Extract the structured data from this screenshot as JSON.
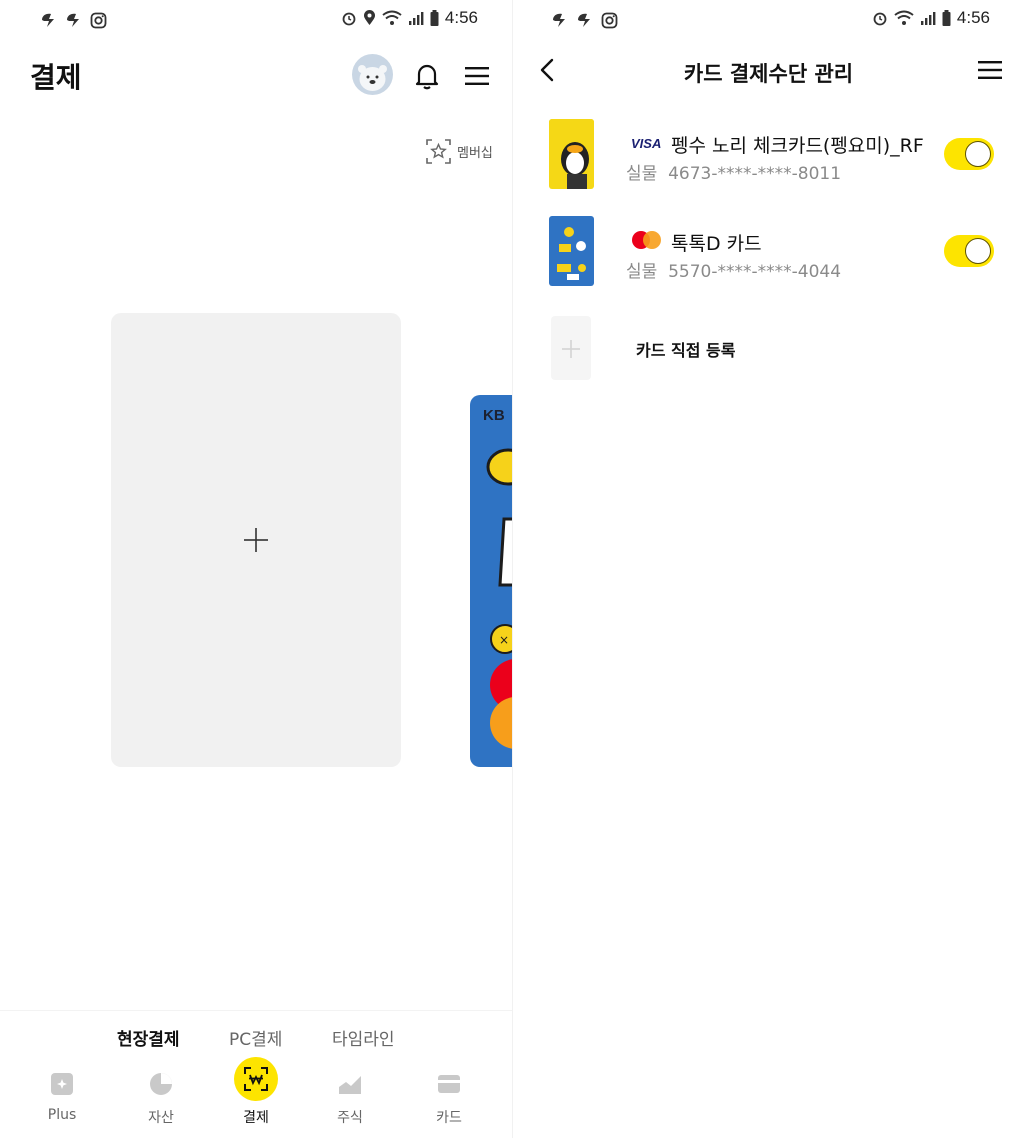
{
  "status_bar": {
    "time": "4:56"
  },
  "left": {
    "header": {
      "title": "결제"
    },
    "membership_label": "멤버십",
    "peek_card_text": "KB",
    "subtabs": [
      {
        "label": "현장결제",
        "active": true
      },
      {
        "label": "PC결제",
        "active": false
      },
      {
        "label": "타임라인",
        "active": false
      }
    ],
    "nav": [
      {
        "label": "Plus",
        "icon": "plus-sparkle-icon"
      },
      {
        "label": "자산",
        "icon": "pie-chart-icon"
      },
      {
        "label": "결제",
        "icon": "pay-won-icon",
        "active": true
      },
      {
        "label": "주식",
        "icon": "stock-chart-icon"
      },
      {
        "label": "카드",
        "icon": "card-icon"
      }
    ]
  },
  "right": {
    "header": {
      "title": "카드 결제수단 관리"
    },
    "cards": [
      {
        "brand": "VISA",
        "name": "펭수 노리 체크카드(펭요미)_RF",
        "type_label": "실물",
        "number": "4673-****-****-8011",
        "enabled": true
      },
      {
        "brand": "mastercard",
        "name": "톡톡D 카드",
        "type_label": "실물",
        "number": "5570-****-****-4044",
        "enabled": true
      }
    ],
    "add_card_label": "카드 직접 등록"
  },
  "colors": {
    "accent": "#fde400",
    "card_blue": "#2f73c3",
    "add_card_bg": "#f1f1f1"
  }
}
